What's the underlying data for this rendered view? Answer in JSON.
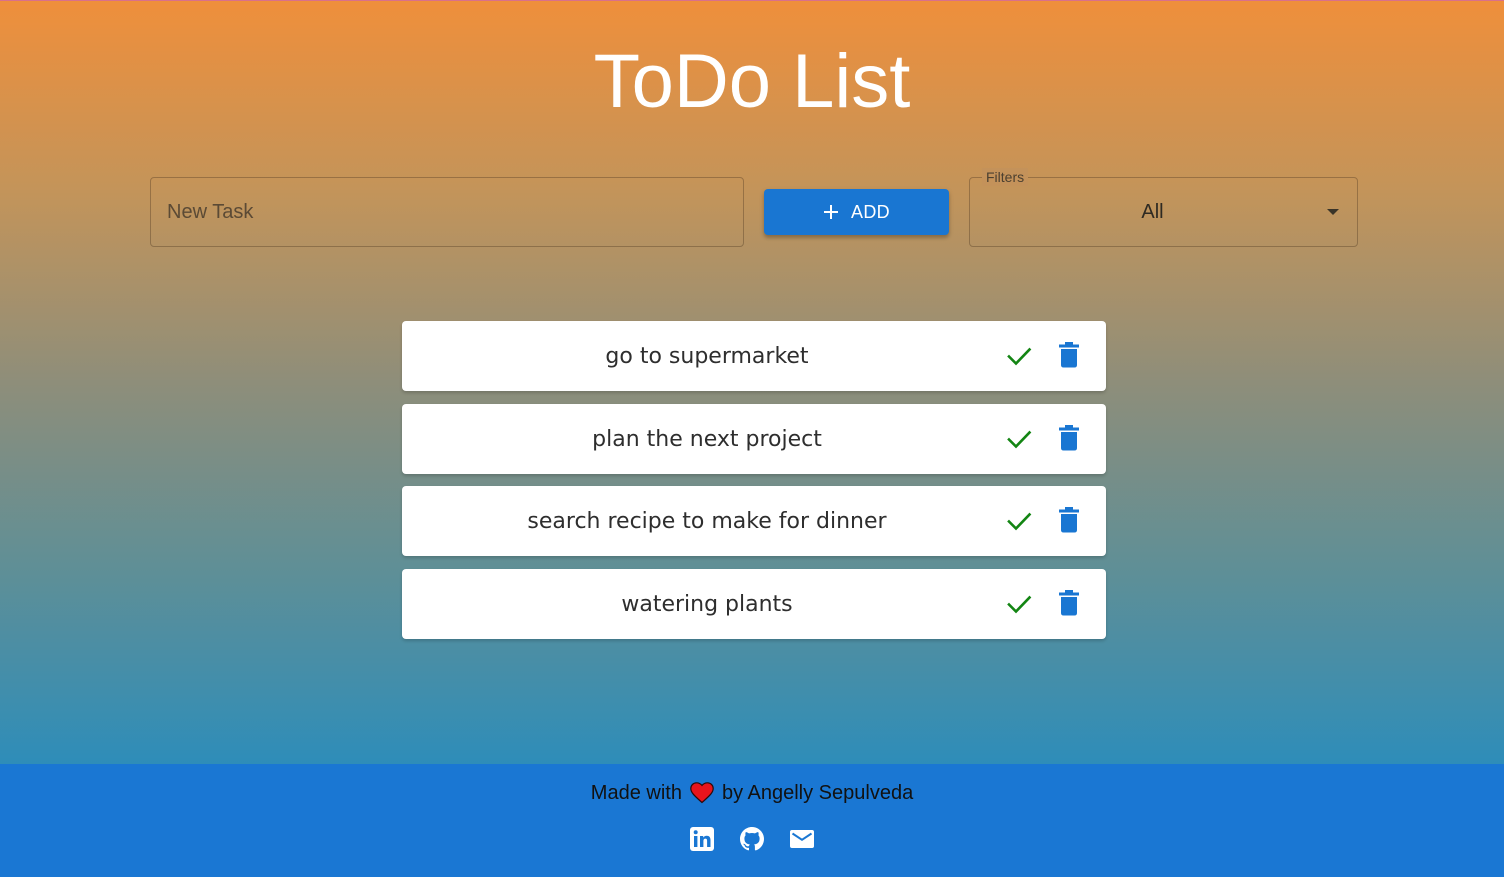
{
  "header": {
    "title": "ToDo List"
  },
  "form": {
    "task_placeholder": "New Task",
    "task_value": "",
    "add_label": "ADD",
    "filter_label": "Filters",
    "filter_value": "All"
  },
  "tasks": [
    {
      "text": "go to supermarket",
      "complete_icon": "check-icon",
      "delete_icon": "trash-icon"
    },
    {
      "text": "plan the next project",
      "complete_icon": "check-icon",
      "delete_icon": "trash-icon"
    },
    {
      "text": "search recipe to make for dinner",
      "complete_icon": "check-icon",
      "delete_icon": "trash-icon"
    },
    {
      "text": "watering plants",
      "complete_icon": "check-icon",
      "delete_icon": "trash-icon"
    }
  ],
  "footer": {
    "made_with": "Made with",
    "by_author": "by Angelly Sepulveda",
    "heart_icon": "heart-icon",
    "links": [
      "linkedin-icon",
      "github-icon",
      "email-icon"
    ]
  },
  "colors": {
    "accent": "#1976d2",
    "check": "#138513",
    "footer_bg": "#1a77d3",
    "gradient_top": "#ef8f3b",
    "gradient_bottom": "#2e8db9"
  }
}
